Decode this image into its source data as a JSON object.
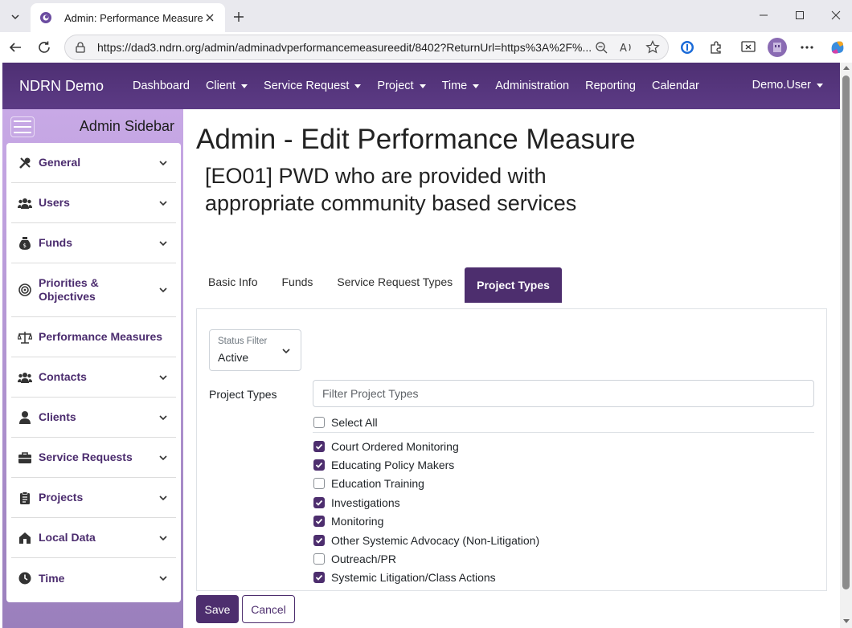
{
  "browser": {
    "tab_title": "Admin: Performance Measure",
    "url": "https://dad3.ndrn.org/admin/adminadvperformancemeasureedit/8402?ReturnUrl=https%3A%2F%..."
  },
  "navbar": {
    "brand": "NDRN Demo",
    "items": [
      {
        "label": "Dashboard",
        "dropdown": false
      },
      {
        "label": "Client",
        "dropdown": true
      },
      {
        "label": "Service Request",
        "dropdown": true
      },
      {
        "label": "Project",
        "dropdown": true
      },
      {
        "label": "Time",
        "dropdown": true
      },
      {
        "label": "Administration",
        "dropdown": false
      },
      {
        "label": "Reporting",
        "dropdown": false
      },
      {
        "label": "Calendar",
        "dropdown": false
      }
    ],
    "user": "Demo.User"
  },
  "sidebar": {
    "title": "Admin Sidebar",
    "items": [
      {
        "label": "General",
        "icon": "tools-icon",
        "expandable": true
      },
      {
        "label": "Users",
        "icon": "users-icon",
        "expandable": true
      },
      {
        "label": "Funds",
        "icon": "money-bag-icon",
        "expandable": true
      },
      {
        "label": "Priorities & Objectives",
        "icon": "target-icon",
        "expandable": true
      },
      {
        "label": "Performance Measures",
        "icon": "scale-icon",
        "expandable": false
      },
      {
        "label": "Contacts",
        "icon": "contacts-icon",
        "expandable": true
      },
      {
        "label": "Clients",
        "icon": "user-icon",
        "expandable": true
      },
      {
        "label": "Service Requests",
        "icon": "briefcase-icon",
        "expandable": true
      },
      {
        "label": "Projects",
        "icon": "clipboard-icon",
        "expandable": true
      },
      {
        "label": "Local Data",
        "icon": "house-icon",
        "expandable": true
      },
      {
        "label": "Time",
        "icon": "clock-icon",
        "expandable": true
      }
    ]
  },
  "page": {
    "title": "Admin - Edit Performance Measure",
    "subtitle": "[EO01] PWD who are provided with appropriate community based services"
  },
  "tabs": [
    {
      "label": "Basic Info",
      "active": false
    },
    {
      "label": "Funds",
      "active": false
    },
    {
      "label": "Service Request Types",
      "active": false
    },
    {
      "label": "Project Types",
      "active": true
    }
  ],
  "status_filter": {
    "label": "Status Filter",
    "value": "Active"
  },
  "project_types": {
    "label": "Project Types",
    "filter_placeholder": "Filter Project Types",
    "select_all_label": "Select All",
    "options": [
      {
        "label": "Court Ordered Monitoring",
        "checked": true
      },
      {
        "label": "Educating Policy Makers",
        "checked": true
      },
      {
        "label": "Education Training",
        "checked": false
      },
      {
        "label": "Investigations",
        "checked": true
      },
      {
        "label": "Monitoring",
        "checked": true
      },
      {
        "label": "Other Systemic Advocacy (Non-Litigation)",
        "checked": true
      },
      {
        "label": "Outreach/PR",
        "checked": false
      },
      {
        "label": "Systemic Litigation/Class Actions",
        "checked": true
      }
    ]
  },
  "buttons": {
    "save": "Save",
    "cancel": "Cancel"
  },
  "colors": {
    "primary": "#4d2e6e",
    "navbar": "#553578",
    "sidebar": "#b898d8"
  }
}
